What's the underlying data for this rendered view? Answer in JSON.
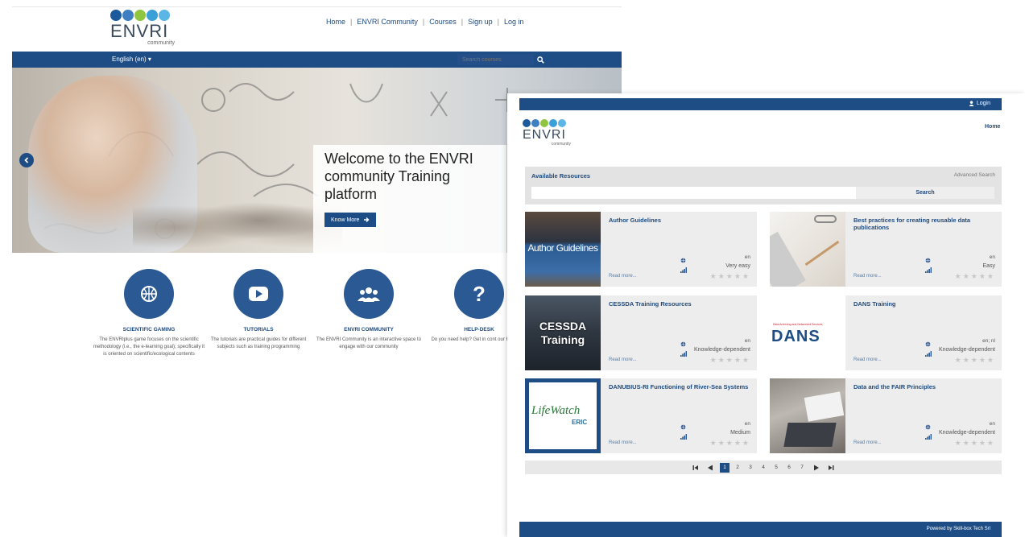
{
  "colors": {
    "brand_blue": "#1e4d85",
    "link_blue": "#1e4a7e",
    "card_bg": "#ededed"
  },
  "logo": {
    "word": "ENVRI",
    "sub": "community",
    "dot_colors": [
      "#1d5a9c",
      "#3d7fc0",
      "#8fc53f",
      "#3aa0d8",
      "#5bb6e6"
    ]
  },
  "left": {
    "nav": [
      "Home",
      "ENVRI Community",
      "Courses",
      "Sign up",
      "Log in"
    ],
    "nav_sep": "|",
    "language": "English (en) ▾",
    "search_placeholder": "Search courses",
    "hero": {
      "welcome": "Welcome to the ENVRI community Training platform",
      "button": "Know More"
    },
    "features": [
      {
        "icon": "basketball-icon",
        "title": "SCIENTIFIC GAMING",
        "desc": "The ENVRIplus game focuses on the scientific methodology (i.e., the e-learning goal); specifically it is oriented on scientific/ecological contents"
      },
      {
        "icon": "play-icon",
        "title": "TUTORIALS",
        "desc": "The tutorials are practical guides for different subjects such as training programming"
      },
      {
        "icon": "users-icon",
        "title": "ENVRI COMMUNITY",
        "desc": "The ENVRI Community is an interactive space to engage with our community"
      },
      {
        "icon": "question-icon",
        "title": "HELP-DESK",
        "desc": "Do you need help? Get in cont our HelpDesk"
      }
    ]
  },
  "right": {
    "login": "Login",
    "home": "Home",
    "available_title": "Available Resources",
    "advanced_search": "Advanced Search",
    "search_button": "Search",
    "cards": [
      {
        "title": "Author Guidelines",
        "lang": "en",
        "level": "Very easy",
        "read_more": "Read more...",
        "thumb_text": "Author Guidelines",
        "thumb_kind": "author"
      },
      {
        "title": "Best practices for creating reusable data publications",
        "lang": "en",
        "level": "Easy",
        "read_more": "Read more...",
        "thumb_text": "",
        "thumb_kind": "desk"
      },
      {
        "title": "CESSDA Training Resources",
        "lang": "en",
        "level": "Knowledge-dependent",
        "read_more": "Read more...",
        "thumb_text": "CESSDA Training",
        "thumb_kind": "cessda"
      },
      {
        "title": "DANS Training",
        "lang": "en; nl",
        "level": "Knowledge-dependent",
        "read_more": "Read more...",
        "thumb_text": "DANS",
        "thumb_kind": "dans",
        "thumb_sub": "Data Archiving and Networked Services"
      },
      {
        "title": "DANUBIUS-RI Functioning of River-Sea Systems",
        "lang": "en",
        "level": "Medium",
        "read_more": "Read more...",
        "thumb_text": "LifeWatch",
        "thumb_kind": "lifewatch",
        "thumb_sub": "ERIC"
      },
      {
        "title": "Data and the FAIR Principles",
        "lang": "en",
        "level": "Knowledge-dependent",
        "read_more": "Read more...",
        "thumb_text": "",
        "thumb_kind": "laptop"
      }
    ],
    "pages": [
      "1",
      "2",
      "3",
      "4",
      "5",
      "6",
      "7"
    ],
    "active_page": "1",
    "footer": "Powered by Skill-box Tech Srl"
  }
}
